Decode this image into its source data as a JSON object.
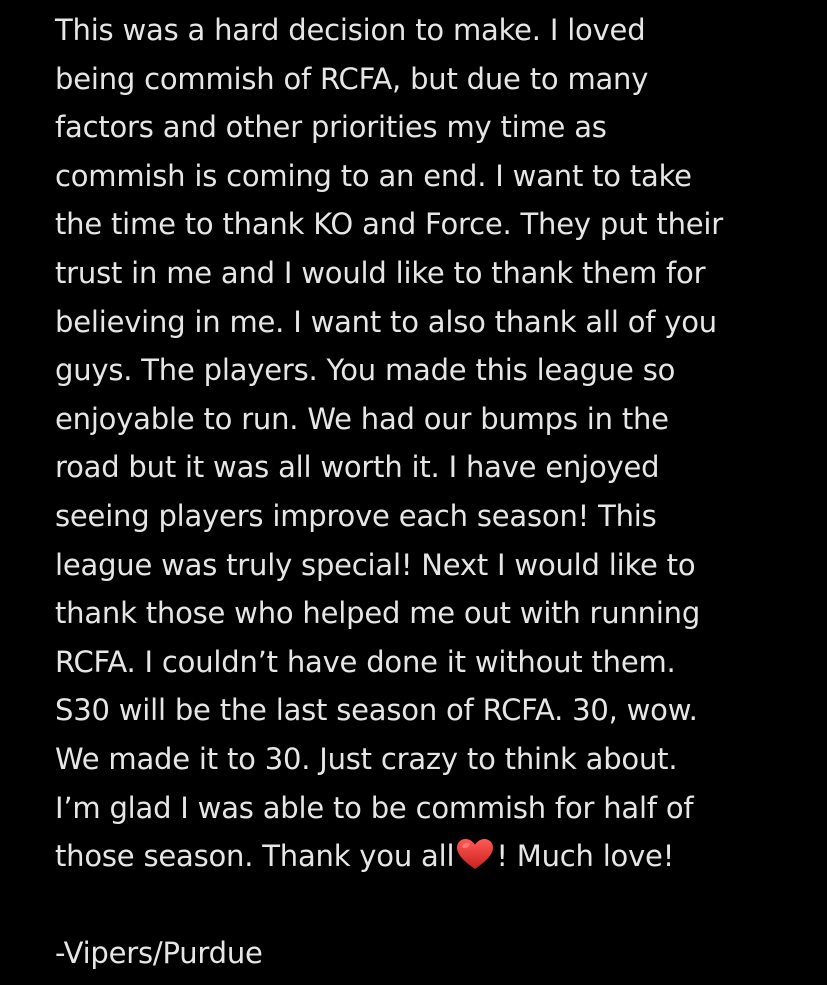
{
  "note": {
    "lines": [
      "This was a hard decision to make. I loved",
      "being commish of RCFA, but due to many",
      "factors and other priorities my time as",
      "commish is coming to an end. I want to take",
      "the time to thank KO and Force. They put their",
      "trust in me and I would like to thank them for",
      "believing in me. I want to also thank all of you",
      "guys. The players. You made this league so",
      "enjoyable to run. We had our bumps in the",
      "road but it was all worth it. I have enjoyed",
      "seeing players improve each season! This",
      "league was truly special! Next I would like to",
      "thank those who helped me out with running",
      "RCFA. I couldn’t have done it without them.",
      "S30 will be the last season of RCFA. 30, wow.",
      "We made it to 30. Just crazy to think about.",
      "I’m glad I was able to be commish for half of"
    ],
    "last_line_before_heart": "those season. Thank you all",
    "last_line_after_heart": "! Much love!",
    "heart_icon": "red-heart-emoji",
    "signature": "-Vipers/Purdue"
  },
  "colors": {
    "background": "#000000",
    "text": "#e6e6e6",
    "heart": "#e0312f"
  }
}
